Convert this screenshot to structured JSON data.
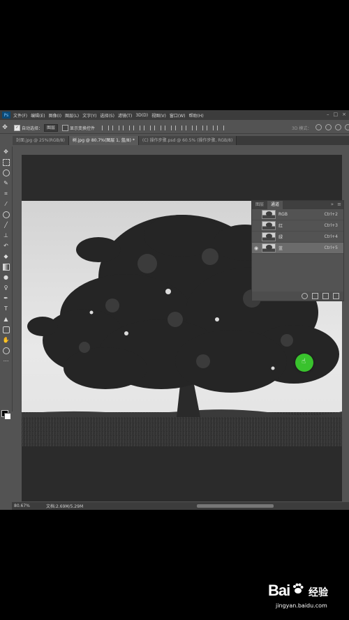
{
  "menubar": {
    "app_icon": "Ps",
    "items": [
      "文件(F)",
      "编辑(E)",
      "图像(I)",
      "图层(L)",
      "文字(Y)",
      "选择(S)",
      "滤镜(T)",
      "3D(D)",
      "视图(V)",
      "窗口(W)",
      "帮助(H)"
    ]
  },
  "options": {
    "auto_select_label": "自动选择：",
    "auto_select_value": "图层",
    "transform_label": "显示变换控件",
    "mode3d_label": "3D 模式："
  },
  "tabs": [
    "封面.jpg @ 25%(RGB/8)",
    "树.jpg @ 80.7%(图层 1, 蓝/8) *",
    "(C) 操作步骤.psd @ 60.5% (操作步骤, RGB/8)"
  ],
  "channels_panel": {
    "tabs": [
      "图层",
      "通道"
    ],
    "rows": [
      {
        "name": "RGB",
        "shortcut": "Ctrl+2"
      },
      {
        "name": "红",
        "shortcut": "Ctrl+3"
      },
      {
        "name": "绿",
        "shortcut": "Ctrl+4"
      },
      {
        "name": "蓝",
        "shortcut": "Ctrl+5"
      }
    ]
  },
  "status": {
    "zoom": "80.67%",
    "doc": "文档:2.69M/5.29M"
  },
  "watermark": {
    "brand_a": "Bai",
    "brand_b": "经验",
    "url": "jingyan.baidu.com"
  }
}
